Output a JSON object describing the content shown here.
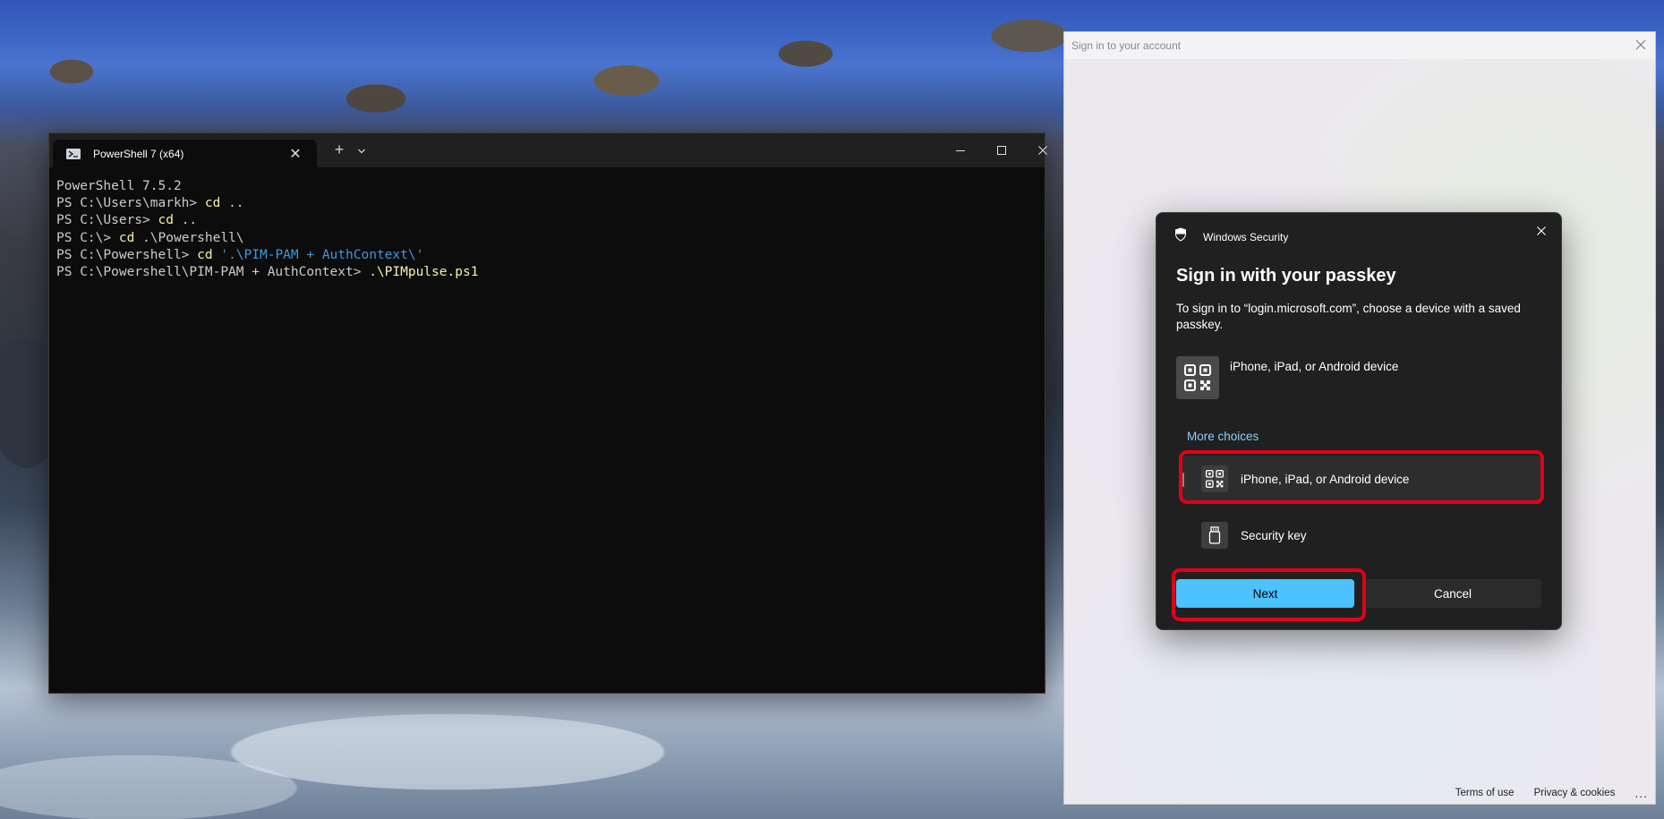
{
  "terminal": {
    "tab_title": "PowerShell 7 (x64)",
    "lines": [
      [
        {
          "t": "PowerShell 7.5.2",
          "c": "arg"
        }
      ],
      [
        {
          "t": "PS C:\\Users\\markh> ",
          "c": "arg"
        },
        {
          "t": "cd",
          "c": "cmd"
        },
        {
          "t": " ..",
          "c": "arg"
        }
      ],
      [
        {
          "t": "PS C:\\Users> ",
          "c": "arg"
        },
        {
          "t": "cd",
          "c": "cmd"
        },
        {
          "t": " ..",
          "c": "arg"
        }
      ],
      [
        {
          "t": "PS C:\\> ",
          "c": "arg"
        },
        {
          "t": "cd",
          "c": "cmd"
        },
        {
          "t": " .\\Powershell\\",
          "c": "arg"
        }
      ],
      [
        {
          "t": "PS C:\\Powershell> ",
          "c": "arg"
        },
        {
          "t": "cd",
          "c": "cmd"
        },
        {
          "t": " ",
          "c": "arg"
        },
        {
          "t": "'.\\PIM-PAM + AuthContext\\'",
          "c": "str"
        }
      ],
      [
        {
          "t": "PS C:\\Powershell\\PIM-PAM + AuthContext> ",
          "c": "arg"
        },
        {
          "t": ".\\PIMpulse.ps1",
          "c": "cmd"
        }
      ]
    ]
  },
  "signin_window": {
    "title": "Sign in to your account",
    "footer": {
      "terms": "Terms of use",
      "privacy": "Privacy & cookies",
      "more": "..."
    }
  },
  "dialog": {
    "app_label": "Windows Security",
    "heading": "Sign in with your passkey",
    "description": "To sign in to “login.microsoft.com”, choose a device with a saved passkey.",
    "primary_device": "iPhone, iPad, or Android device",
    "more_choices": "More choices",
    "choices": [
      {
        "label": "iPhone, iPad, or Android device",
        "icon": "qr-code-icon"
      },
      {
        "label": "Security key",
        "icon": "usb-key-icon"
      }
    ],
    "next_label": "Next",
    "cancel_label": "Cancel",
    "accent_color": "#4cc2ff",
    "highlight_color": "#e0001b"
  }
}
